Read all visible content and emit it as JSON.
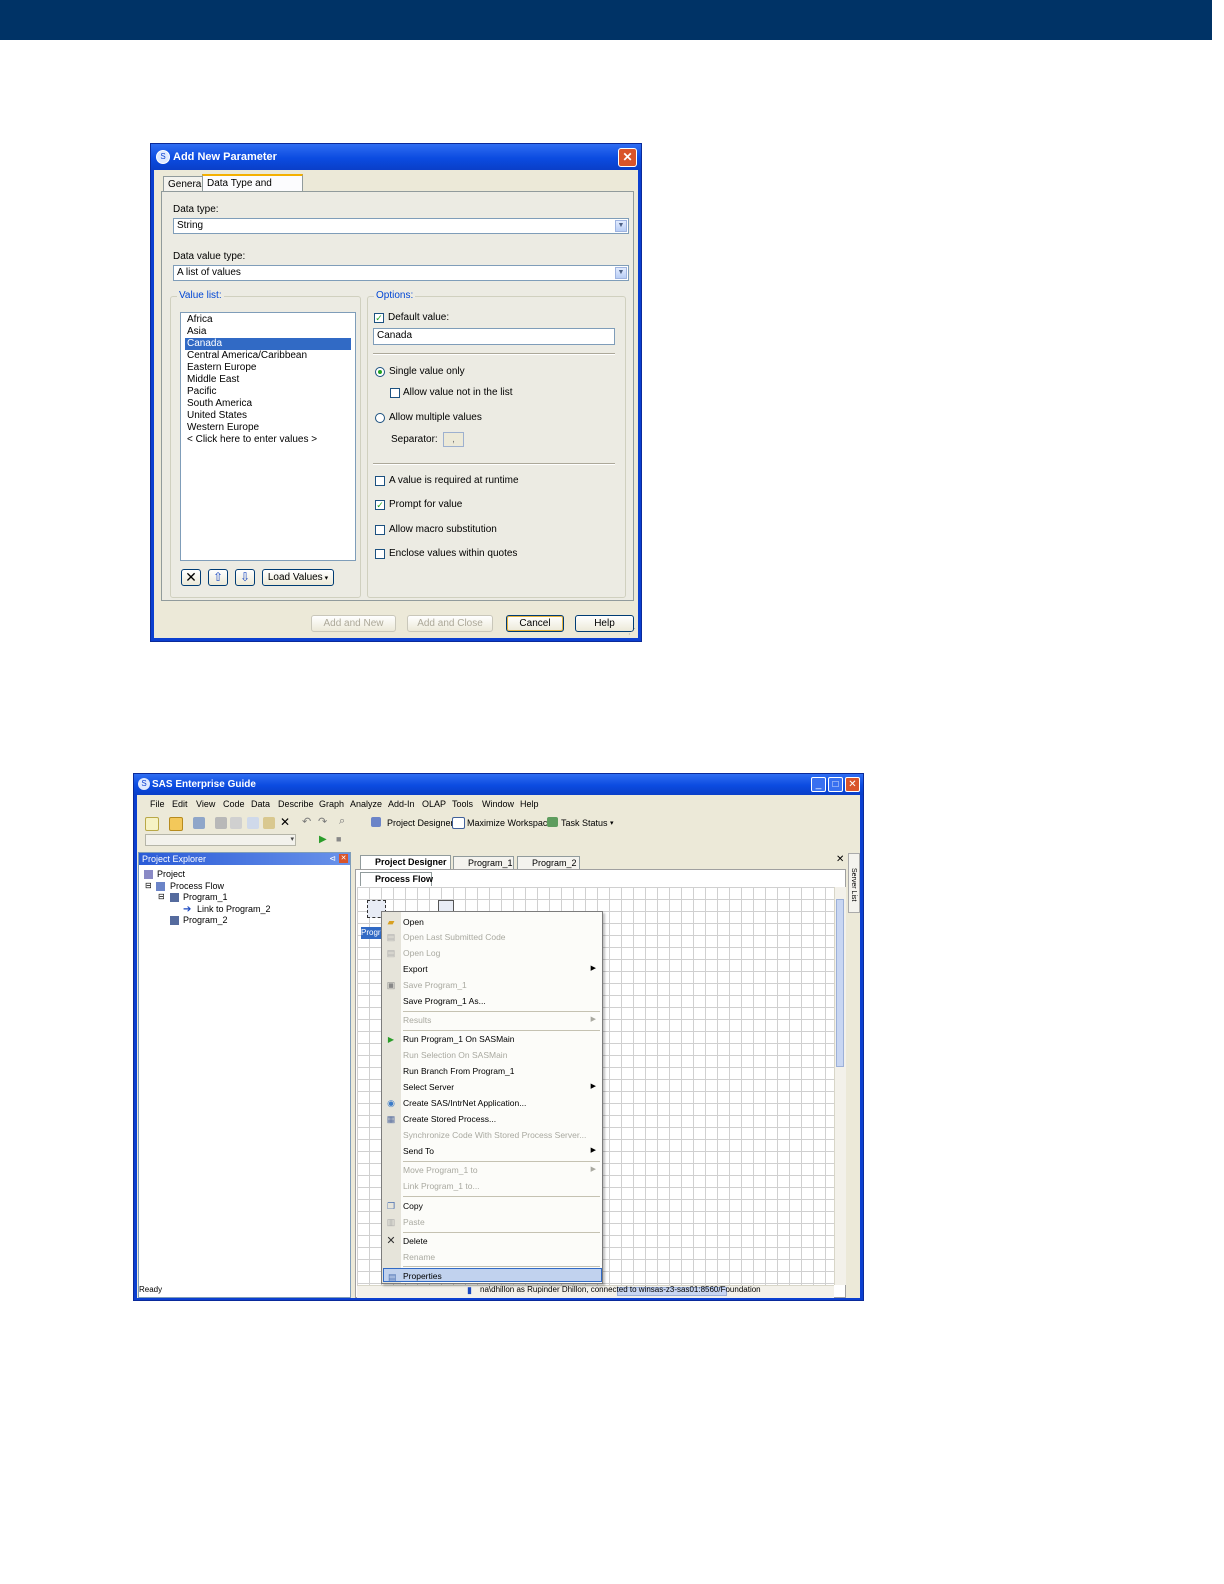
{
  "dialog": {
    "title": "Add New Parameter",
    "tabs": [
      {
        "label": "General"
      },
      {
        "label": "Data Type and Values"
      }
    ],
    "data_type": {
      "label": "Data type:",
      "value": "String"
    },
    "data_value_type": {
      "label": "Data value type:",
      "value": "A list of values"
    },
    "value_list": {
      "title": "Value list:",
      "items": [
        "Africa",
        "Asia",
        "Canada",
        "Central America/Caribbean",
        "Eastern Europe",
        "Middle East",
        "Pacific",
        "South America",
        "United States",
        "Western Europe",
        "< Click here to enter values >"
      ],
      "selected": "Canada",
      "load_values_label": "Load Values"
    },
    "options": {
      "title": "Options:",
      "default_value_label": "Default value:",
      "default_value": "Canada",
      "single_value_label": "Single value only",
      "allow_not_in_list_label": "Allow value not in the list",
      "allow_multiple_label": "Allow multiple values",
      "separator_label": "Separator:",
      "separator_value": ",",
      "required_label": "A value is required at runtime",
      "prompt_label": "Prompt for value",
      "macro_label": "Allow macro substitution",
      "quotes_label": "Enclose values within quotes"
    },
    "buttons": {
      "add_new": "Add and New",
      "add_close": "Add and Close",
      "cancel": "Cancel",
      "help": "Help"
    }
  },
  "sas": {
    "title": "SAS Enterprise Guide",
    "menu": [
      "File",
      "Edit",
      "View",
      "Code",
      "Data",
      "Describe",
      "Graph",
      "Analyze",
      "Add-In",
      "OLAP",
      "Tools",
      "Window",
      "Help"
    ],
    "toolbar": {
      "project_designer": "Project Designer",
      "maximize_workspace": "Maximize Workspace",
      "task_status": "Task Status"
    },
    "project_explorer": {
      "title": "Project Explorer",
      "tree": [
        "Project",
        "Process Flow",
        "Program_1",
        "Link to Program_2",
        "Program_2"
      ]
    },
    "doc_tabs": [
      "Project Designer",
      "Program_1",
      "Program_2"
    ],
    "process_flow_tab": "Process Flow",
    "server_list": "Server List",
    "node_label": "Progra",
    "context_menu": [
      {
        "label": "Open",
        "enabled": true
      },
      {
        "label": "Open Last Submitted Code",
        "enabled": false
      },
      {
        "label": "Open Log",
        "enabled": false
      },
      {
        "label": "Export",
        "enabled": true
      },
      {
        "label": "Save Program_1",
        "enabled": false
      },
      {
        "label": "Save Program_1 As...",
        "enabled": true
      },
      {
        "label": "Results",
        "enabled": false
      },
      {
        "label": "Run Program_1 On SASMain",
        "enabled": true
      },
      {
        "label": "Run Selection On SASMain",
        "enabled": false
      },
      {
        "label": "Run Branch From Program_1",
        "enabled": true
      },
      {
        "label": "Select Server",
        "enabled": true
      },
      {
        "label": "Create SAS/IntrNet Application...",
        "enabled": true
      },
      {
        "label": "Create Stored Process...",
        "enabled": true
      },
      {
        "label": "Synchronize Code With Stored Process Server...",
        "enabled": false
      },
      {
        "label": "Send To",
        "enabled": true
      },
      {
        "label": "Move Program_1 to",
        "enabled": false
      },
      {
        "label": "Link Program_1 to...",
        "enabled": false
      },
      {
        "label": "Copy",
        "enabled": true
      },
      {
        "label": "Paste",
        "enabled": false
      },
      {
        "label": "Delete",
        "enabled": true
      },
      {
        "label": "Rename",
        "enabled": false
      },
      {
        "label": "Properties",
        "enabled": true
      }
    ],
    "status": {
      "ready": "Ready",
      "connection": "na\\dhillon as Rupinder Dhillon, connected to winsas-z3-sas01:8560/Foundation"
    }
  }
}
